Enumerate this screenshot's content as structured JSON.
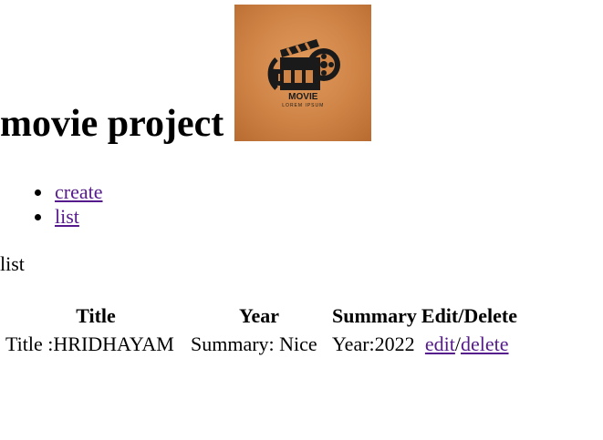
{
  "header": {
    "title": "movie project",
    "logo": {
      "icon": "film-clapperboard-icon",
      "word": "MOVIE",
      "tagline": "LOREM IPSUM",
      "bg_color": "#cf8446"
    }
  },
  "nav": {
    "items": [
      {
        "label": "create"
      },
      {
        "label": "list"
      }
    ]
  },
  "section_label": "list",
  "table": {
    "headers": [
      "Title",
      "Year",
      "Summary",
      "Edit/Delete"
    ],
    "rows": [
      {
        "title": "Title :HRIDHAYAM",
        "summary": "Summary: Nice",
        "year": "Year:2022",
        "edit": "edit",
        "separator": "/",
        "delete": "delete"
      }
    ]
  },
  "colors": {
    "link": "#551a8b",
    "text": "#000000",
    "background": "#ffffff"
  }
}
